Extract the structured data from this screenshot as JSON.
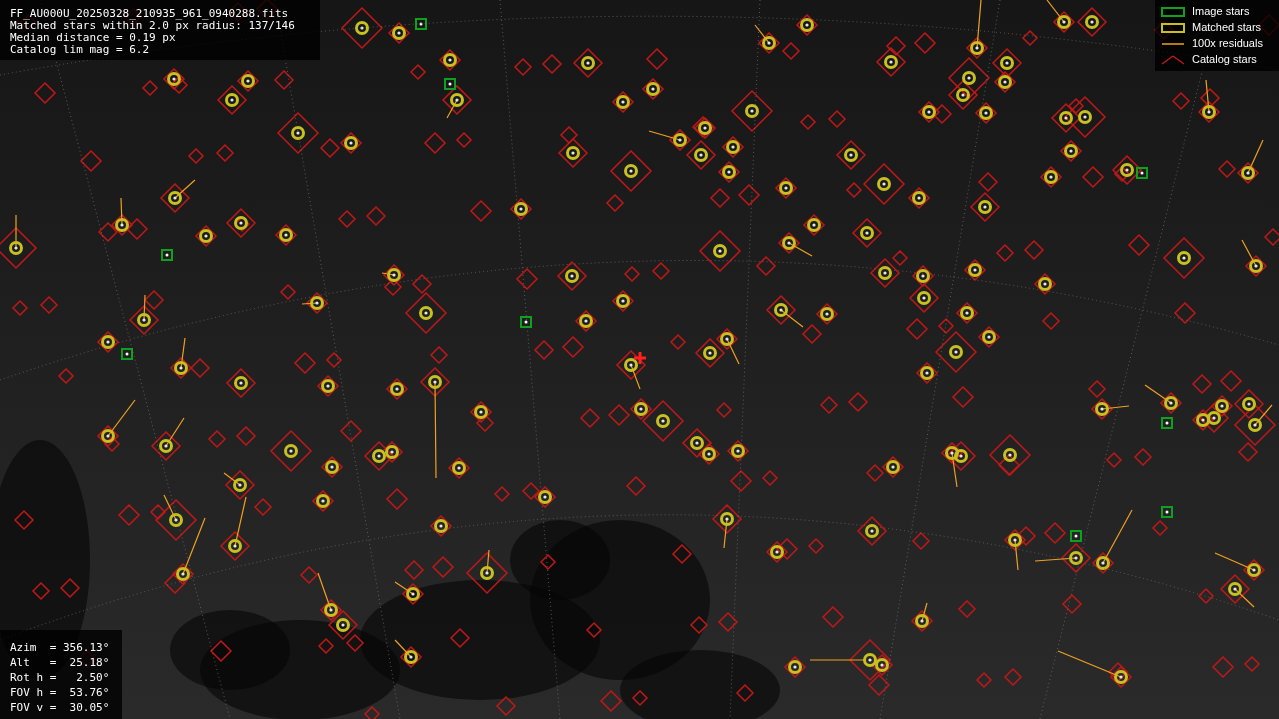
{
  "file_info": [
    "FF_AU000U_20250328_210935_961_0940288.fits",
    "Matched stars within 2.0 px radius: 137/146",
    "Median distance = 0.19 px",
    "Catalog lim mag = 6.2"
  ],
  "legend": [
    {
      "kind": "image",
      "label": "Image stars"
    },
    {
      "kind": "matched",
      "label": "Matched stars"
    },
    {
      "kind": "residual",
      "label": "100x residuals"
    },
    {
      "kind": "catalog",
      "label": "Catalog stars"
    }
  ],
  "fit_params": [
    "Azim  = 356.13°",
    "Alt   =  25.18°",
    "Rot h =   2.50°",
    "FOV h =  53.76°",
    "FOV v =  30.05°"
  ]
}
